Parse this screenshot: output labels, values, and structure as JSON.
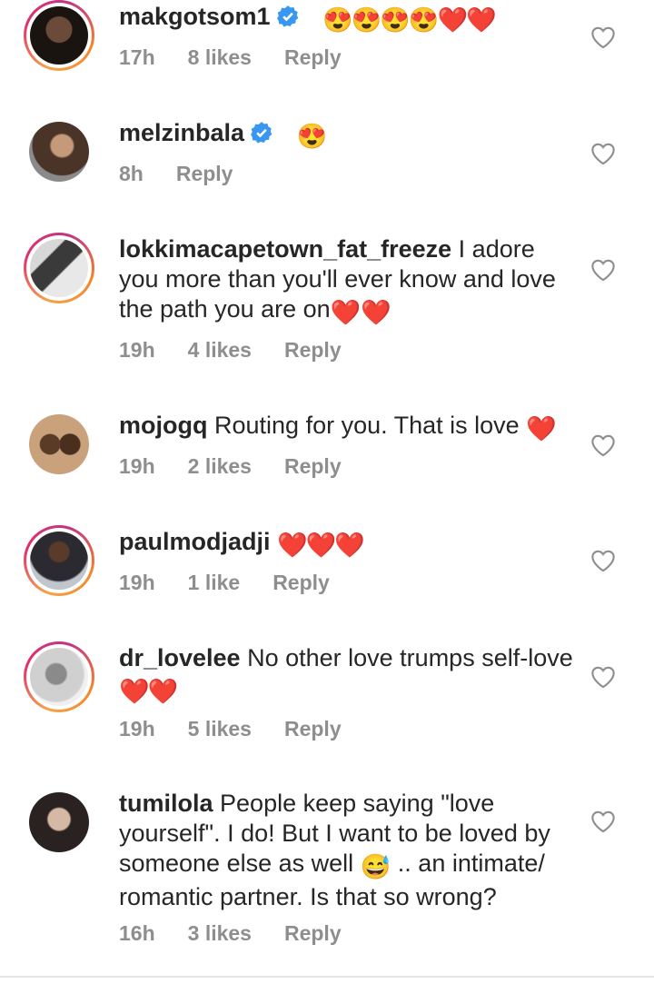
{
  "comments": [
    {
      "username": "makgotsom1",
      "verified": true,
      "text": "",
      "emojis": "😍😍😍😍❤️❤️",
      "time": "17h",
      "likes": "8 likes",
      "reply": "Reply"
    },
    {
      "username": "melzinbala",
      "verified": true,
      "text": "",
      "emojis": "😍",
      "time": "8h",
      "likes": "",
      "reply": "Reply"
    },
    {
      "username": "lokkimacapetown_fat_freeze",
      "verified": false,
      "text": "I adore you more than you'll ever know and love the path you are on",
      "emojis": "❤️❤️",
      "time": "19h",
      "likes": "4 likes",
      "reply": "Reply"
    },
    {
      "username": "mojogq",
      "verified": false,
      "text": "Routing for you. That is love",
      "emojis": "❤️",
      "time": "19h",
      "likes": "2 likes",
      "reply": "Reply"
    },
    {
      "username": "paulmodjadji",
      "verified": false,
      "text": "",
      "emojis": "❤️❤️❤️",
      "time": "19h",
      "likes": "1 like",
      "reply": "Reply"
    },
    {
      "username": "dr_lovelee",
      "verified": false,
      "text": "No other love trumps self-love",
      "emojis": "❤️❤️",
      "time": "19h",
      "likes": "5 likes",
      "reply": "Reply"
    },
    {
      "username": "tumilola",
      "verified": false,
      "text": "People keep saying \"love yourself\". I do! But I want to be loved by someone else as well",
      "emojis": "😅",
      "text2": ".. an intimate/ romantic partner. Is that so wrong?",
      "time": "16h",
      "likes": "3 likes",
      "reply": "Reply"
    }
  ],
  "colors": {
    "meta": "#8e8e8e",
    "heart_red": "#e0202c",
    "verified_blue": "#3897f0"
  },
  "icons": {
    "like": "heart-outline-icon",
    "verified": "verified-badge-icon"
  }
}
